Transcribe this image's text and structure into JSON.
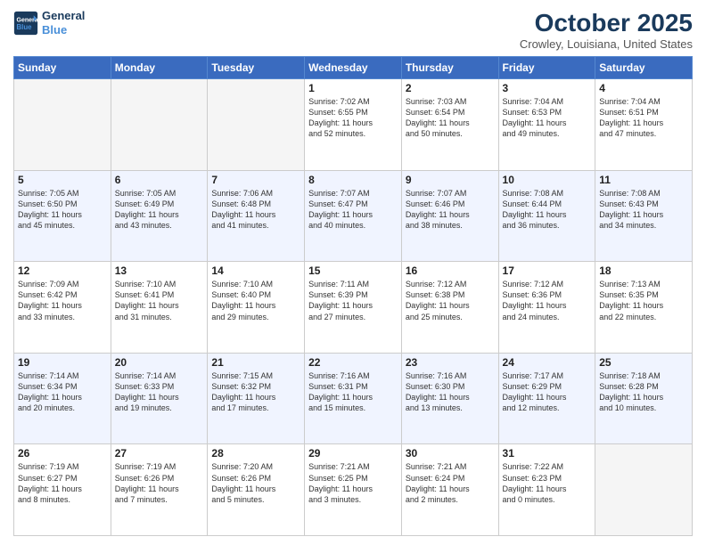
{
  "logo": {
    "line1": "General",
    "line2": "Blue"
  },
  "title": "October 2025",
  "location": "Crowley, Louisiana, United States",
  "days_of_week": [
    "Sunday",
    "Monday",
    "Tuesday",
    "Wednesday",
    "Thursday",
    "Friday",
    "Saturday"
  ],
  "weeks": [
    [
      {
        "day": "",
        "empty": true,
        "text": ""
      },
      {
        "day": "",
        "empty": true,
        "text": ""
      },
      {
        "day": "",
        "empty": true,
        "text": ""
      },
      {
        "day": "1",
        "empty": false,
        "text": "Sunrise: 7:02 AM\nSunset: 6:55 PM\nDaylight: 11 hours\nand 52 minutes."
      },
      {
        "day": "2",
        "empty": false,
        "text": "Sunrise: 7:03 AM\nSunset: 6:54 PM\nDaylight: 11 hours\nand 50 minutes."
      },
      {
        "day": "3",
        "empty": false,
        "text": "Sunrise: 7:04 AM\nSunset: 6:53 PM\nDaylight: 11 hours\nand 49 minutes."
      },
      {
        "day": "4",
        "empty": false,
        "text": "Sunrise: 7:04 AM\nSunset: 6:51 PM\nDaylight: 11 hours\nand 47 minutes."
      }
    ],
    [
      {
        "day": "5",
        "empty": false,
        "text": "Sunrise: 7:05 AM\nSunset: 6:50 PM\nDaylight: 11 hours\nand 45 minutes."
      },
      {
        "day": "6",
        "empty": false,
        "text": "Sunrise: 7:05 AM\nSunset: 6:49 PM\nDaylight: 11 hours\nand 43 minutes."
      },
      {
        "day": "7",
        "empty": false,
        "text": "Sunrise: 7:06 AM\nSunset: 6:48 PM\nDaylight: 11 hours\nand 41 minutes."
      },
      {
        "day": "8",
        "empty": false,
        "text": "Sunrise: 7:07 AM\nSunset: 6:47 PM\nDaylight: 11 hours\nand 40 minutes."
      },
      {
        "day": "9",
        "empty": false,
        "text": "Sunrise: 7:07 AM\nSunset: 6:46 PM\nDaylight: 11 hours\nand 38 minutes."
      },
      {
        "day": "10",
        "empty": false,
        "text": "Sunrise: 7:08 AM\nSunset: 6:44 PM\nDaylight: 11 hours\nand 36 minutes."
      },
      {
        "day": "11",
        "empty": false,
        "text": "Sunrise: 7:08 AM\nSunset: 6:43 PM\nDaylight: 11 hours\nand 34 minutes."
      }
    ],
    [
      {
        "day": "12",
        "empty": false,
        "text": "Sunrise: 7:09 AM\nSunset: 6:42 PM\nDaylight: 11 hours\nand 33 minutes."
      },
      {
        "day": "13",
        "empty": false,
        "text": "Sunrise: 7:10 AM\nSunset: 6:41 PM\nDaylight: 11 hours\nand 31 minutes."
      },
      {
        "day": "14",
        "empty": false,
        "text": "Sunrise: 7:10 AM\nSunset: 6:40 PM\nDaylight: 11 hours\nand 29 minutes."
      },
      {
        "day": "15",
        "empty": false,
        "text": "Sunrise: 7:11 AM\nSunset: 6:39 PM\nDaylight: 11 hours\nand 27 minutes."
      },
      {
        "day": "16",
        "empty": false,
        "text": "Sunrise: 7:12 AM\nSunset: 6:38 PM\nDaylight: 11 hours\nand 25 minutes."
      },
      {
        "day": "17",
        "empty": false,
        "text": "Sunrise: 7:12 AM\nSunset: 6:36 PM\nDaylight: 11 hours\nand 24 minutes."
      },
      {
        "day": "18",
        "empty": false,
        "text": "Sunrise: 7:13 AM\nSunset: 6:35 PM\nDaylight: 11 hours\nand 22 minutes."
      }
    ],
    [
      {
        "day": "19",
        "empty": false,
        "text": "Sunrise: 7:14 AM\nSunset: 6:34 PM\nDaylight: 11 hours\nand 20 minutes."
      },
      {
        "day": "20",
        "empty": false,
        "text": "Sunrise: 7:14 AM\nSunset: 6:33 PM\nDaylight: 11 hours\nand 19 minutes."
      },
      {
        "day": "21",
        "empty": false,
        "text": "Sunrise: 7:15 AM\nSunset: 6:32 PM\nDaylight: 11 hours\nand 17 minutes."
      },
      {
        "day": "22",
        "empty": false,
        "text": "Sunrise: 7:16 AM\nSunset: 6:31 PM\nDaylight: 11 hours\nand 15 minutes."
      },
      {
        "day": "23",
        "empty": false,
        "text": "Sunrise: 7:16 AM\nSunset: 6:30 PM\nDaylight: 11 hours\nand 13 minutes."
      },
      {
        "day": "24",
        "empty": false,
        "text": "Sunrise: 7:17 AM\nSunset: 6:29 PM\nDaylight: 11 hours\nand 12 minutes."
      },
      {
        "day": "25",
        "empty": false,
        "text": "Sunrise: 7:18 AM\nSunset: 6:28 PM\nDaylight: 11 hours\nand 10 minutes."
      }
    ],
    [
      {
        "day": "26",
        "empty": false,
        "text": "Sunrise: 7:19 AM\nSunset: 6:27 PM\nDaylight: 11 hours\nand 8 minutes."
      },
      {
        "day": "27",
        "empty": false,
        "text": "Sunrise: 7:19 AM\nSunset: 6:26 PM\nDaylight: 11 hours\nand 7 minutes."
      },
      {
        "day": "28",
        "empty": false,
        "text": "Sunrise: 7:20 AM\nSunset: 6:26 PM\nDaylight: 11 hours\nand 5 minutes."
      },
      {
        "day": "29",
        "empty": false,
        "text": "Sunrise: 7:21 AM\nSunset: 6:25 PM\nDaylight: 11 hours\nand 3 minutes."
      },
      {
        "day": "30",
        "empty": false,
        "text": "Sunrise: 7:21 AM\nSunset: 6:24 PM\nDaylight: 11 hours\nand 2 minutes."
      },
      {
        "day": "31",
        "empty": false,
        "text": "Sunrise: 7:22 AM\nSunset: 6:23 PM\nDaylight: 11 hours\nand 0 minutes."
      },
      {
        "day": "",
        "empty": true,
        "text": ""
      }
    ]
  ]
}
